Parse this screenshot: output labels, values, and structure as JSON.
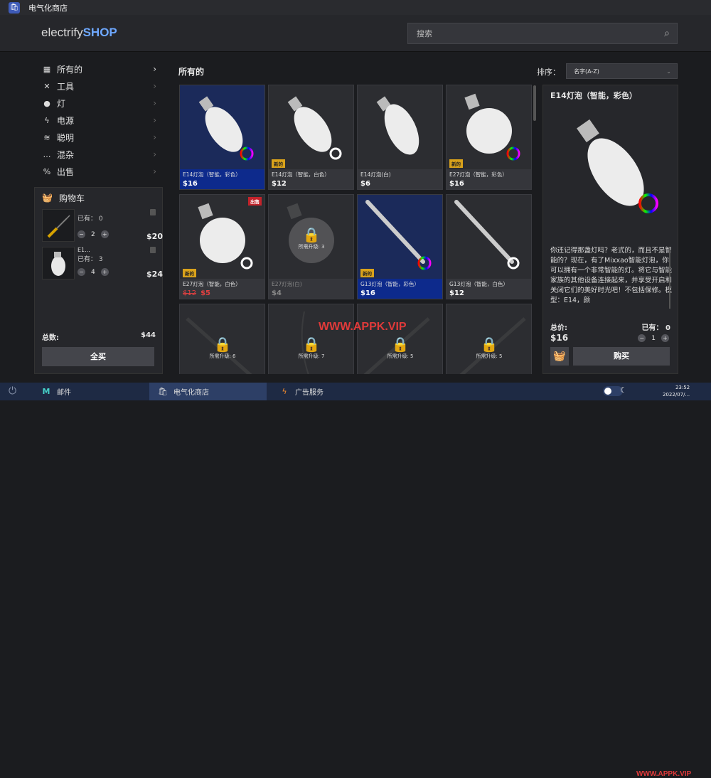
{
  "window": {
    "title": "电气化商店"
  },
  "header": {
    "logo_prefix": "electrify",
    "logo_suffix": "SHOP",
    "search_placeholder": "搜索"
  },
  "sidebar": {
    "items": [
      {
        "label": "所有的",
        "icon": "grid-icon"
      },
      {
        "label": "工具",
        "icon": "tools-icon"
      },
      {
        "label": "灯",
        "icon": "bulb-icon"
      },
      {
        "label": "电源",
        "icon": "lightning-icon"
      },
      {
        "label": "聪明",
        "icon": "wifi-icon"
      },
      {
        "label": "混杂",
        "icon": "dots-icon"
      },
      {
        "label": "出售",
        "icon": "percent-icon"
      }
    ]
  },
  "cart": {
    "title": "购物车",
    "items": [
      {
        "name": "",
        "have": "已有： 0",
        "qty": "2",
        "price": "$20"
      },
      {
        "name": "E1...",
        "have": "已有： 3",
        "qty": "4",
        "price": "$24"
      }
    ],
    "total_label": "总数:",
    "total_value": "$44",
    "buy_all": "全买"
  },
  "main": {
    "section_title": "所有的",
    "sort_label": "排序：",
    "sort_value": "名字(A-Z)"
  },
  "products": [
    {
      "name": "E14灯泡（智能，彩色）",
      "price": "$16",
      "badge": "",
      "ring": "color"
    },
    {
      "name": "E14灯泡（智能，白色）",
      "price": "$12",
      "badge": "新的",
      "ring": "white"
    },
    {
      "name": "E14灯泡(白)",
      "price": "$6",
      "badge": "",
      "ring": ""
    },
    {
      "name": "E27灯泡（智能，彩色）",
      "price": "$16",
      "badge": "新的",
      "ring": "color"
    },
    {
      "name": "E27灯泡（智能，白色）",
      "old_price": "$12",
      "sale_price": "$5",
      "badge": "新的",
      "sale_badge": "出售",
      "ring": "white"
    },
    {
      "name": "E27灯泡(白)",
      "price": "$4",
      "lock_text": "所需升级: 3"
    },
    {
      "name": "G13灯泡（智能，彩色）",
      "price": "$16",
      "badge": "新的",
      "ring": "color"
    },
    {
      "name": "G13灯泡（智能，白色）",
      "price": "$12",
      "badge": "",
      "ring": "white"
    },
    {
      "lock_text": "所需升级: 6"
    },
    {
      "lock_text": "所需升级: 7"
    },
    {
      "lock_text": "所需升级: 5"
    },
    {
      "lock_text": "所需升级: 5"
    }
  ],
  "detail": {
    "title": "E14灯泡（智能，彩色）",
    "description": "你还记得那盏灯吗？老式的，而且不是智能的？现在，有了Mixxao智能灯泡，你可以拥有一个非常智能的灯。将它与智能家族的其他设备连接起来，并享受开启和关闭它们的美好时光吧！不包括保修。模型：E14，颜",
    "total_label": "总价:",
    "have_label": "已有： 0",
    "price": "$16",
    "qty": "1",
    "buy": "购买"
  },
  "taskbar": {
    "mail": "邮件",
    "shop": "电气化商店",
    "ads": "广告服务",
    "time": "23:52",
    "date": "2022/07/..."
  },
  "watermark": "WWW.APPK.VIP",
  "colors": {
    "accent": "#6ea8ff",
    "selected_card": "#0d2a8c",
    "new_badge": "#d9a21b",
    "sale_badge": "#c4232b"
  }
}
